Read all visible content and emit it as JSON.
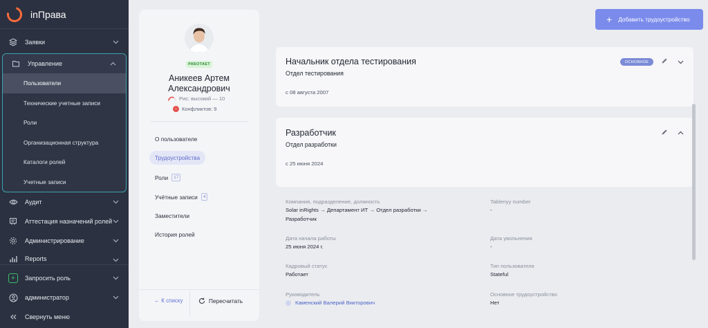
{
  "app": {
    "title": "inПрава"
  },
  "sidebar": {
    "items_top": [
      {
        "label": "Заявки",
        "icon": "layers-icon"
      }
    ],
    "group": {
      "label": "Управление",
      "icon": "folder-icon",
      "items": [
        {
          "label": "Пользователи",
          "active": true
        },
        {
          "label": "Технические учетные записи"
        },
        {
          "label": "Роли"
        },
        {
          "label": "Организационная структура"
        },
        {
          "label": "Каталоги ролей"
        },
        {
          "label": "Учетные записи"
        }
      ]
    },
    "items_bottom": [
      {
        "label": "Аудит",
        "icon": "eye-icon"
      },
      {
        "label": "Аттестация назначений ролей",
        "icon": "attestation-icon"
      },
      {
        "label": "Администрирование",
        "icon": "gear-icon"
      },
      {
        "label": "Reports",
        "icon": "bar-chart-icon"
      }
    ],
    "request_role": "Запросить роль",
    "user": "администратор",
    "collapse": "Свернуть меню"
  },
  "profile": {
    "status": "РАБОТАЕТ",
    "name_line1": "Аникеев Артем",
    "name_line2": "Александрович",
    "risk": "Рис: высокий — 10",
    "conflicts": "Конфликтов: 9",
    "tabs": [
      {
        "label": "О пользователе"
      },
      {
        "label": "Трудоустройства",
        "active": true
      },
      {
        "label": "Роли",
        "count": "17"
      },
      {
        "label": "Учётные записи",
        "count": "4"
      },
      {
        "label": "Заместители"
      },
      {
        "label": "История ролей"
      }
    ],
    "back": "← К списку",
    "refresh": "Пересчитать"
  },
  "main": {
    "add_button": "Добавить трудоустройство",
    "jobs": [
      {
        "title": "Начальник отдела тестирования",
        "dept": "Отдел тестирования",
        "date": "с 08 августа 2007",
        "badge": "ОСНОВНОЕ"
      },
      {
        "title": "Разработчик",
        "dept": "Отдел разработки",
        "date": "с 25 июня 2024"
      }
    ],
    "details": {
      "company_label": "Компания, подразделение, должность",
      "company_value_1": "Solar inRights → Департамент ИТ → Отдел разработки →",
      "company_value_2": "Разработчик",
      "tabnum_label": "Tablenyy number",
      "tabnum_value": "-",
      "start_label": "Дата начала работы",
      "start_value": "25 июня 2024 г.",
      "end_label": "Дата увольнения",
      "end_value": "-",
      "hr_label": "Кадровый статус",
      "hr_value": "Работает",
      "type_label": "Тип пользователя",
      "type_value": "Stateful",
      "manager_label": "Руководитель",
      "manager_value": "Каменский Валерий Викторович",
      "primary_label": "Основное трудоустройство",
      "primary_value": "Нет"
    }
  }
}
